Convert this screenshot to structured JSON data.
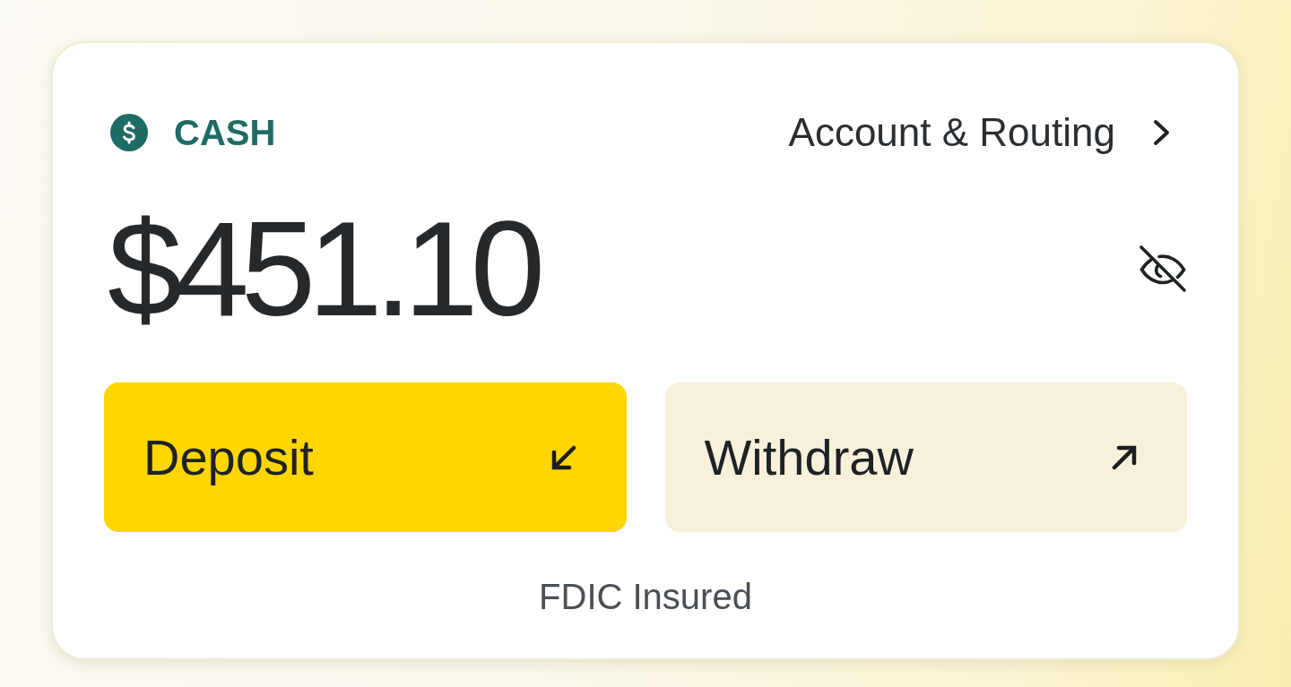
{
  "account": {
    "label": "CASH",
    "link": "Account & Routing"
  },
  "balance": {
    "amount": "$451.10"
  },
  "actions": [
    {
      "label": "Deposit",
      "kind": "primary"
    },
    {
      "label": "Withdraw",
      "kind": "secondary"
    }
  ],
  "footer": "FDIC Insured"
}
